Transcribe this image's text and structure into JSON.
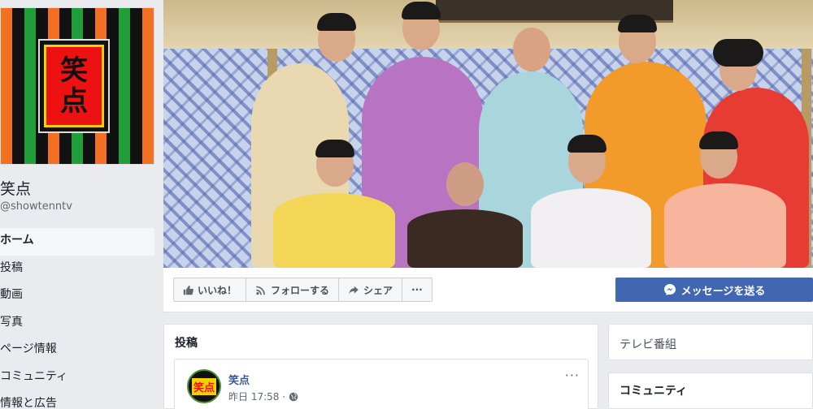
{
  "page": {
    "name": "笑点",
    "handle": "@showtenntv",
    "logo_text": [
      "笑",
      "点"
    ]
  },
  "nav": {
    "items": [
      {
        "label": "ホーム",
        "active": true
      },
      {
        "label": "投稿"
      },
      {
        "label": "動画"
      },
      {
        "label": "写真"
      },
      {
        "label": "ページ情報"
      },
      {
        "label": "コミュニティ"
      },
      {
        "label": "情報と広告"
      }
    ]
  },
  "actions": {
    "like": "いいね！",
    "follow": "フォローする",
    "share": "シェア",
    "more": "···",
    "message": "メッセージを送る"
  },
  "posts": {
    "title": "投稿",
    "items": [
      {
        "author": "笑点",
        "time": "昨日 17:58 ·",
        "more": "···"
      }
    ]
  },
  "sidebar_right": {
    "category": "テレビ番組",
    "community_title": "コミュニティ"
  },
  "colors": {
    "brand_blue": "#4267b2",
    "link_blue": "#385898",
    "background": "#e9ebee"
  }
}
